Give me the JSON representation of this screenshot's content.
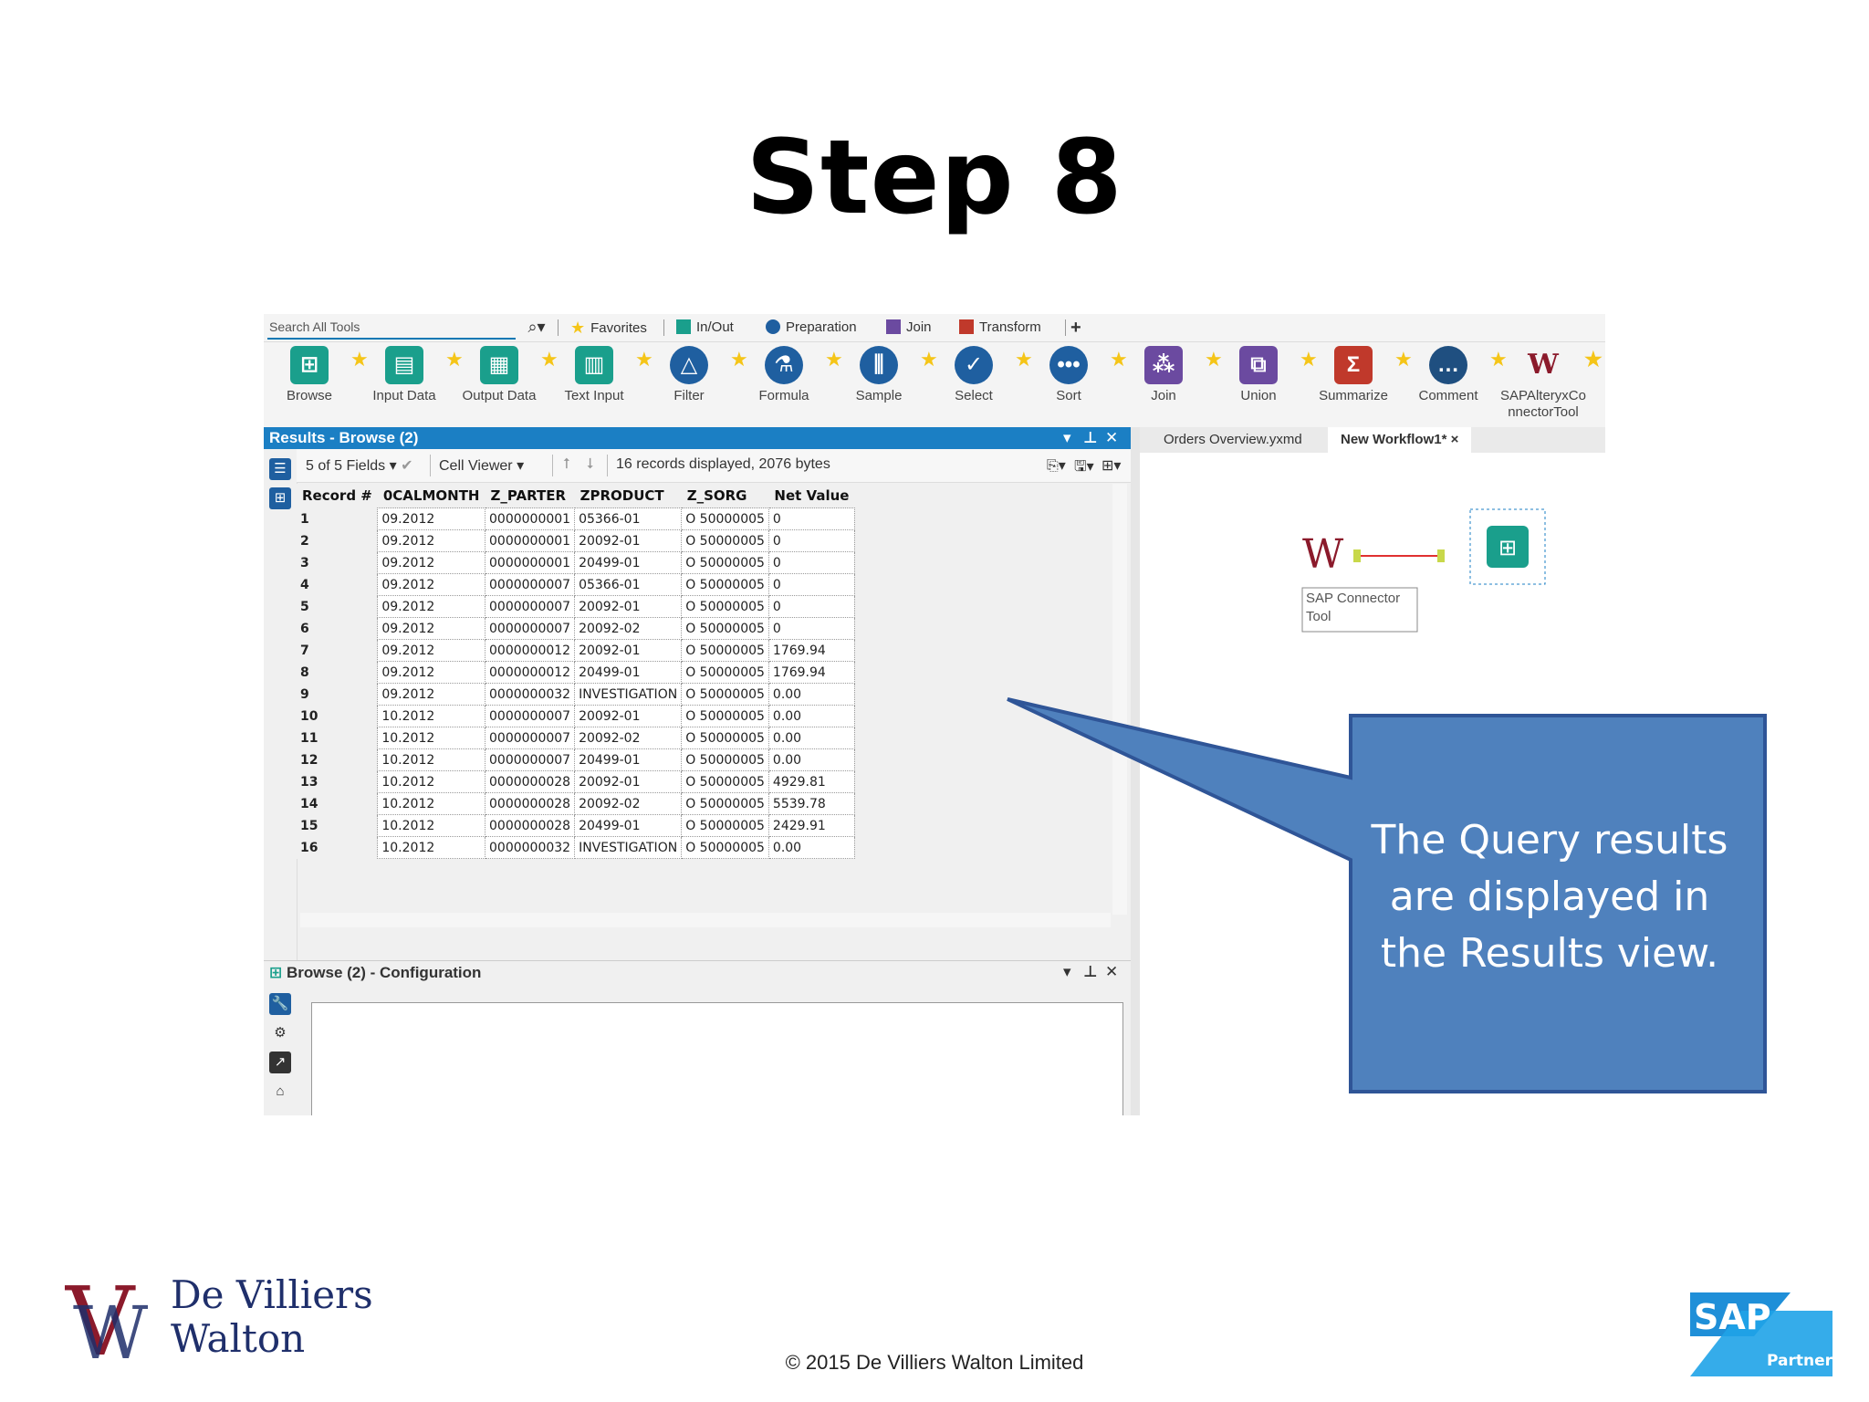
{
  "slide": {
    "title": "Step 8",
    "callout_text": "The Query results are displayed in the Results view.",
    "copyright": "© 2015 De Villiers Walton Limited",
    "logo_line1": "De Villiers",
    "logo_line2": "Walton",
    "sap_logo_text": "SAP",
    "sap_partner_text": "Partner"
  },
  "ribbon": {
    "search_placeholder": "Search All Tools",
    "search_icon": "search-icon",
    "tabs": [
      {
        "label": "Favorites",
        "color": "#f5c518"
      },
      {
        "label": "In/Out",
        "color": "#1a9f8c"
      },
      {
        "label": "Preparation",
        "color": "#1f5fa0"
      },
      {
        "label": "Join",
        "color": "#6b4aa0"
      },
      {
        "label": "Transform",
        "color": "#c0392b"
      },
      {
        "label": "+",
        "color": "#333333"
      }
    ],
    "tools": [
      {
        "label": "Browse",
        "icon": "binoculars-icon",
        "color": "#1a9f8c"
      },
      {
        "label": "Input Data",
        "icon": "book-icon",
        "color": "#1a9f8c"
      },
      {
        "label": "Output Data",
        "icon": "book-out-icon",
        "color": "#1a9f8c"
      },
      {
        "label": "Text Input",
        "icon": "text-book-icon",
        "color": "#1a9f8c"
      },
      {
        "label": "Filter",
        "icon": "filter-icon",
        "color": "#1f5fa0"
      },
      {
        "label": "Formula",
        "icon": "flask-icon",
        "color": "#1f5fa0"
      },
      {
        "label": "Sample",
        "icon": "sample-icon",
        "color": "#1f5fa0"
      },
      {
        "label": "Select",
        "icon": "check-icon",
        "color": "#1f5fa0"
      },
      {
        "label": "Sort",
        "icon": "sort-icon",
        "color": "#1f5fa0"
      },
      {
        "label": "Join",
        "icon": "join-icon",
        "color": "#6b4aa0"
      },
      {
        "label": "Union",
        "icon": "union-icon",
        "color": "#6b4aa0"
      },
      {
        "label": "Summarize",
        "icon": "sigma-icon",
        "color": "#c0392b"
      },
      {
        "label": "Comment",
        "icon": "comment-icon",
        "color": "#1f4f80"
      },
      {
        "label": "SAPAlteryxCo nnectorTool",
        "icon": "dvw-logo-icon",
        "color": "#8b1a2b"
      }
    ]
  },
  "results": {
    "title": "Results - Browse (2)",
    "fields_dropdown": "5 of 5 Fields",
    "viewer_dropdown": "Cell Viewer",
    "status": "16 records displayed, 2076 bytes",
    "columns": [
      "Record #",
      "0CALMONTH",
      "Z_PARTER",
      "ZPRODUCT",
      "Z_SORG",
      "Net Value"
    ],
    "rows": [
      [
        "1",
        "09.2012",
        "0000000001",
        "05366-01",
        "O 50000005",
        "0"
      ],
      [
        "2",
        "09.2012",
        "0000000001",
        "20092-01",
        "O 50000005",
        "0"
      ],
      [
        "3",
        "09.2012",
        "0000000001",
        "20499-01",
        "O 50000005",
        "0"
      ],
      [
        "4",
        "09.2012",
        "0000000007",
        "05366-01",
        "O 50000005",
        "0"
      ],
      [
        "5",
        "09.2012",
        "0000000007",
        "20092-01",
        "O 50000005",
        "0"
      ],
      [
        "6",
        "09.2012",
        "0000000007",
        "20092-02",
        "O 50000005",
        "0"
      ],
      [
        "7",
        "09.2012",
        "0000000012",
        "20092-01",
        "O 50000005",
        "1769.94"
      ],
      [
        "8",
        "09.2012",
        "0000000012",
        "20499-01",
        "O 50000005",
        "1769.94"
      ],
      [
        "9",
        "09.2012",
        "0000000032",
        "INVESTIGATION",
        "O 50000005",
        "0.00"
      ],
      [
        "10",
        "10.2012",
        "0000000007",
        "20092-01",
        "O 50000005",
        "0.00"
      ],
      [
        "11",
        "10.2012",
        "0000000007",
        "20092-02",
        "O 50000005",
        "0.00"
      ],
      [
        "12",
        "10.2012",
        "0000000007",
        "20499-01",
        "O 50000005",
        "0.00"
      ],
      [
        "13",
        "10.2012",
        "0000000028",
        "20092-01",
        "O 50000005",
        "4929.81"
      ],
      [
        "14",
        "10.2012",
        "0000000028",
        "20092-02",
        "O 50000005",
        "5539.78"
      ],
      [
        "15",
        "10.2012",
        "0000000028",
        "20499-01",
        "O 50000005",
        "2429.91"
      ],
      [
        "16",
        "10.2012",
        "0000000032",
        "INVESTIGATION",
        "O 50000005",
        "0.00"
      ]
    ]
  },
  "config": {
    "title": "Browse (2) - Configuration"
  },
  "canvas": {
    "tabs": [
      "Orders Overview.yxmd",
      "New Workflow1*"
    ],
    "tab_close": "×",
    "node_label": "SAP Connector Tool"
  }
}
